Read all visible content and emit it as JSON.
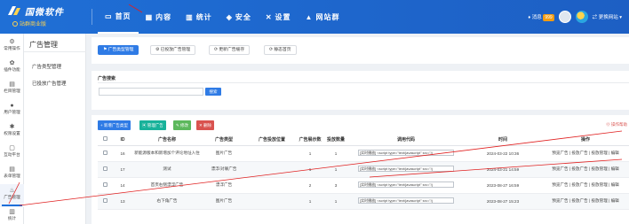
{
  "brand": {
    "name": "国微软件",
    "subtitle": "站群商业版",
    "colors": {
      "primary": "#1e6fd9",
      "accent": "#ffd34d",
      "annotation": "#e02020"
    }
  },
  "topnav": [
    {
      "label": "首页",
      "icon": "monitor-icon",
      "glyph": "▭",
      "active": true
    },
    {
      "label": "内容",
      "icon": "grid-icon",
      "glyph": "▦",
      "active": false
    },
    {
      "label": "统计",
      "icon": "bar-chart-icon",
      "glyph": "▥",
      "active": false
    },
    {
      "label": "安全",
      "icon": "shield-icon",
      "glyph": "◈",
      "active": false
    },
    {
      "label": "设置",
      "icon": "cross-icon",
      "glyph": "✕",
      "active": false
    },
    {
      "label": "网站群",
      "icon": "sites-icon",
      "glyph": "▲",
      "active": false
    }
  ],
  "topright": {
    "messages_label": "消息",
    "messages_count": "999",
    "site_label": "更换网站"
  },
  "rail": [
    {
      "label": "常用操作",
      "icon": "gear-icon",
      "glyph": "⚙"
    },
    {
      "label": "插件功能",
      "icon": "plugin-icon",
      "glyph": "✿"
    },
    {
      "label": "栏目管理",
      "icon": "folder-icon",
      "glyph": "▤"
    },
    {
      "label": "用户管理",
      "icon": "user-icon",
      "glyph": "●"
    },
    {
      "label": "权限设置",
      "icon": "key-icon",
      "glyph": "✱"
    },
    {
      "label": "互动平台",
      "icon": "chat-icon",
      "glyph": "▢"
    },
    {
      "label": "表单管理",
      "icon": "form-icon",
      "glyph": "▤"
    },
    {
      "label": "广告管理",
      "icon": "ad-icon",
      "glyph": "♨",
      "active": true
    },
    {
      "label": "统计",
      "icon": "chart-icon",
      "glyph": "▥"
    }
  ],
  "submenu": {
    "title": "广告管理",
    "items": [
      "广告类型管理",
      "已投放广告管理"
    ]
  },
  "tabs": [
    {
      "label": "广告类型管理",
      "icon": "flag-icon",
      "active": true
    },
    {
      "label": "已投放广告管理",
      "icon": "wrench-icon",
      "active": false
    },
    {
      "label": "更新广告缓存",
      "icon": "refresh-icon",
      "active": false
    },
    {
      "label": "静态首页",
      "icon": "refresh-icon",
      "active": false
    }
  ],
  "search": {
    "title": "广告搜索",
    "placeholder": "",
    "button": "搜索"
  },
  "toolbar": {
    "add": "+ 新增广告类型",
    "batch": "▣ 管理广告",
    "edit": "✎ 修改",
    "delete": "✕ 删除",
    "export": "操作帮助"
  },
  "table": {
    "headers": [
      "",
      "ID",
      "广告名称",
      "广告类型",
      "广告投放位置",
      "广告展示数",
      "投放数量",
      "调用代码",
      "时间",
      "操作"
    ],
    "rows": [
      {
        "id": "16",
        "name": "新能源版本和新增加个评论地址入住",
        "type": "图片广告",
        "position": "",
        "shows": "1",
        "count": "1",
        "code": "[实时播放] <script type=\"text/javascript\" src=\"/j",
        "time": "2024-03-22 10:36",
        "ops": "预览广告 | 投放广告 | 投放管理 | 编辑"
      },
      {
        "id": "17",
        "name": "测试",
        "type": "漂浮/对联广告",
        "position": "",
        "shows": "1",
        "count": "1",
        "code": "[实时播放] <script type=\"text/javascript\" src=\"/j",
        "time": "2024-03-21 14:59",
        "ops": "预览广告 | 投放广告 | 投放管理 | 编辑"
      },
      {
        "id": "14",
        "name": "首页右侧漂浮广告",
        "type": "漂浮广告",
        "position": "",
        "shows": "2",
        "count": "3",
        "code": "[实时播放] <script type=\"text/javascript\" src=\"/j",
        "time": "2023-08-27 16:59",
        "ops": "预览广告 | 投放广告 | 投放管理 | 编辑"
      },
      {
        "id": "13",
        "name": "右下角广告",
        "type": "图片广告",
        "position": "",
        "shows": "1",
        "count": "1",
        "code": "[实时播放] <script type=\"text/javascript\" src=\"/j",
        "time": "2023-08-27 15:23",
        "ops": "预览广告 | 投放广告 | 投放管理 | 编辑"
      }
    ]
  }
}
